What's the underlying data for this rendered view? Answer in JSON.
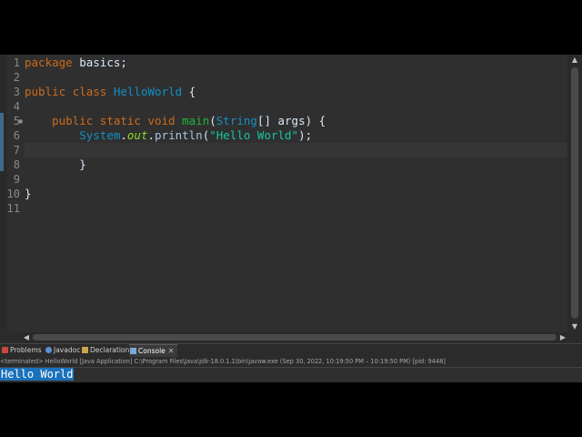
{
  "editor": {
    "line_numbers": [
      "1",
      "2",
      "3",
      "4",
      "5",
      "6",
      "7",
      "8",
      "9",
      "10",
      "11"
    ],
    "code": {
      "l1_kw": "package",
      "l1_rest": " basics;",
      "l3_kw1": "public",
      "l3_kw2": "class",
      "l3_name": "HelloWorld",
      "l3_brace": " {",
      "l5_kw1": "public",
      "l5_kw2": "static",
      "l5_kw3": "void",
      "l5_method": "main",
      "l5_paren": "(",
      "l5_type": "String",
      "l5_rest": "[] args) {",
      "l6_sys": "System",
      "l6_dot1": ".",
      "l6_out": "out",
      "l6_dot2": ".",
      "l6_println": "println",
      "l6_open": "(",
      "l6_str": "\"Hello World\"",
      "l6_close": ");",
      "l8_brace": "}",
      "l10_brace": "}"
    },
    "fold_marker": "●"
  },
  "views": {
    "tabs": [
      {
        "label": "Problems",
        "color": "#c8483d"
      },
      {
        "label": "Javadoc",
        "color": "#5b8fd6"
      },
      {
        "label": "Declaration",
        "color": "#c9a64a"
      },
      {
        "label": "Console",
        "color": "#7aa9d8"
      }
    ],
    "close_glyph": "✕"
  },
  "console": {
    "terminated_info": "<terminated> HelloWorld [Java Application] C:\\Program Files\\Java\\jdk-18.0.1.1\\bin\\javaw.exe  (Sep 30, 2022, 10:19:50 PM – 10:19:50 PM) [pid: 9448]",
    "output": "Hello World"
  }
}
